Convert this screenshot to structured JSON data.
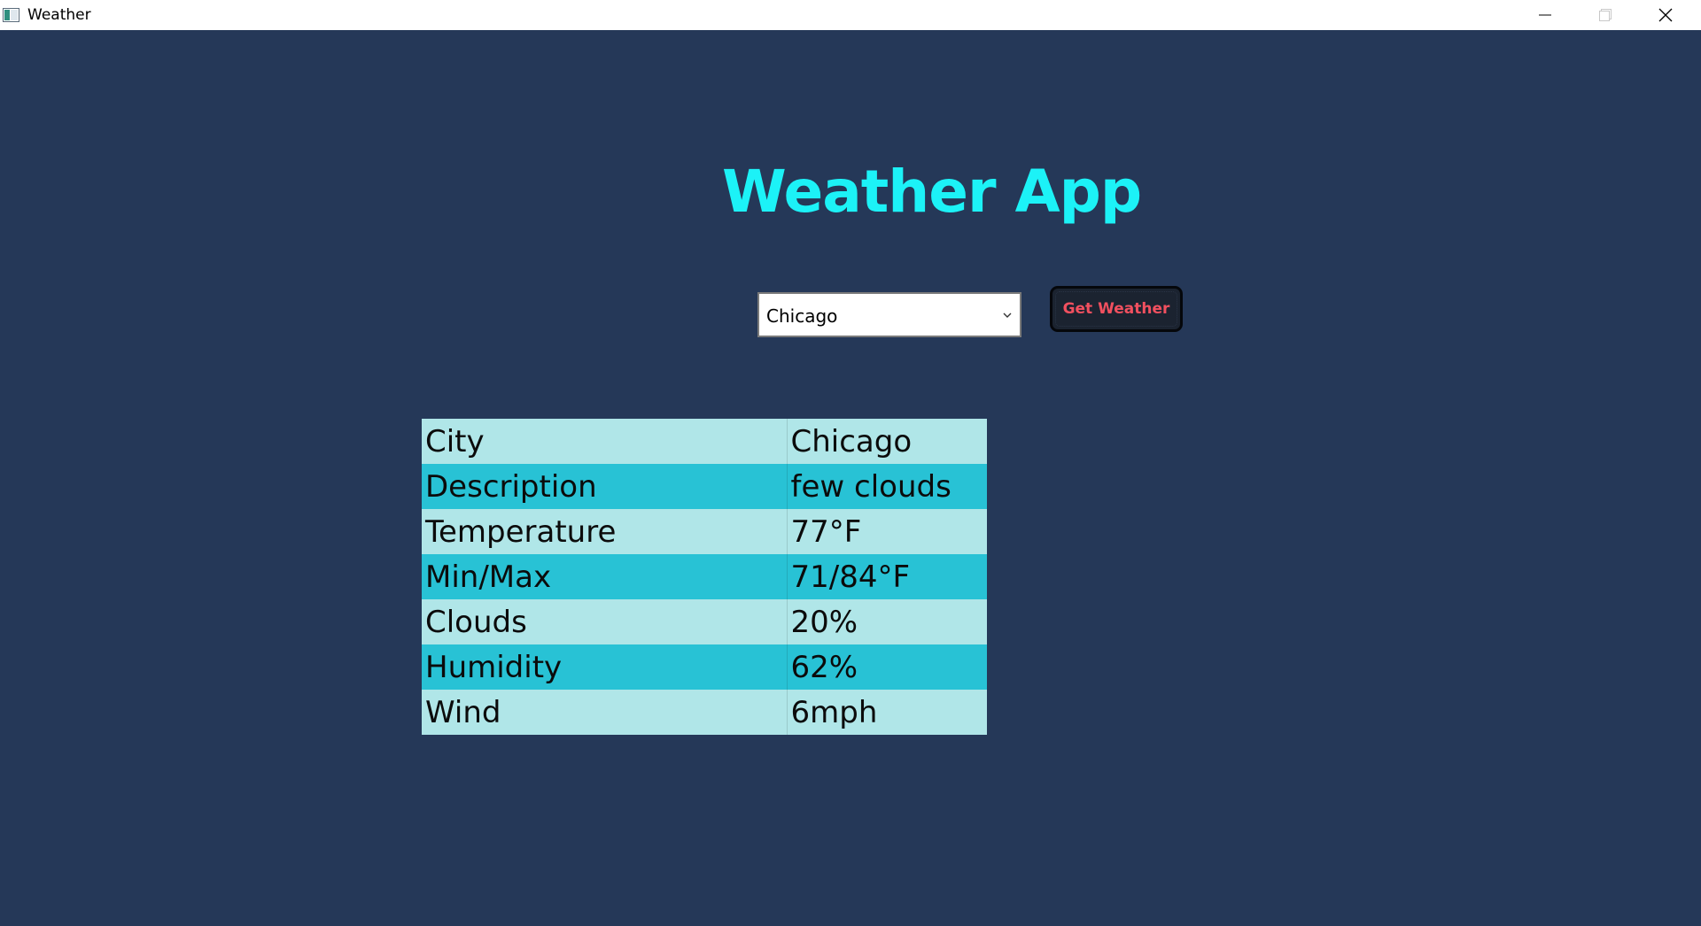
{
  "window": {
    "title": "Weather",
    "controls": [
      "minimize-icon",
      "maximize-icon",
      "close-icon"
    ]
  },
  "app": {
    "title": "Weather App"
  },
  "city_select": {
    "selected": "Chicago"
  },
  "button": {
    "label": "Get Weather"
  },
  "weather": {
    "rows": [
      {
        "label": "City",
        "value": "Chicago"
      },
      {
        "label": "Description",
        "value": "few clouds"
      },
      {
        "label": "Temperature",
        "value": "77°F"
      },
      {
        "label": "Min/Max",
        "value": "71/84°F"
      },
      {
        "label": "Clouds",
        "value": "20%"
      },
      {
        "label": "Humidity",
        "value": "62%"
      },
      {
        "label": "Wind",
        "value": "6mph"
      }
    ]
  },
  "colors": {
    "background": "#253858",
    "title": "#1cf2f7",
    "button_text": "#f1505f",
    "row_light": "#b0e6e8",
    "row_dark": "#28c2d5"
  }
}
